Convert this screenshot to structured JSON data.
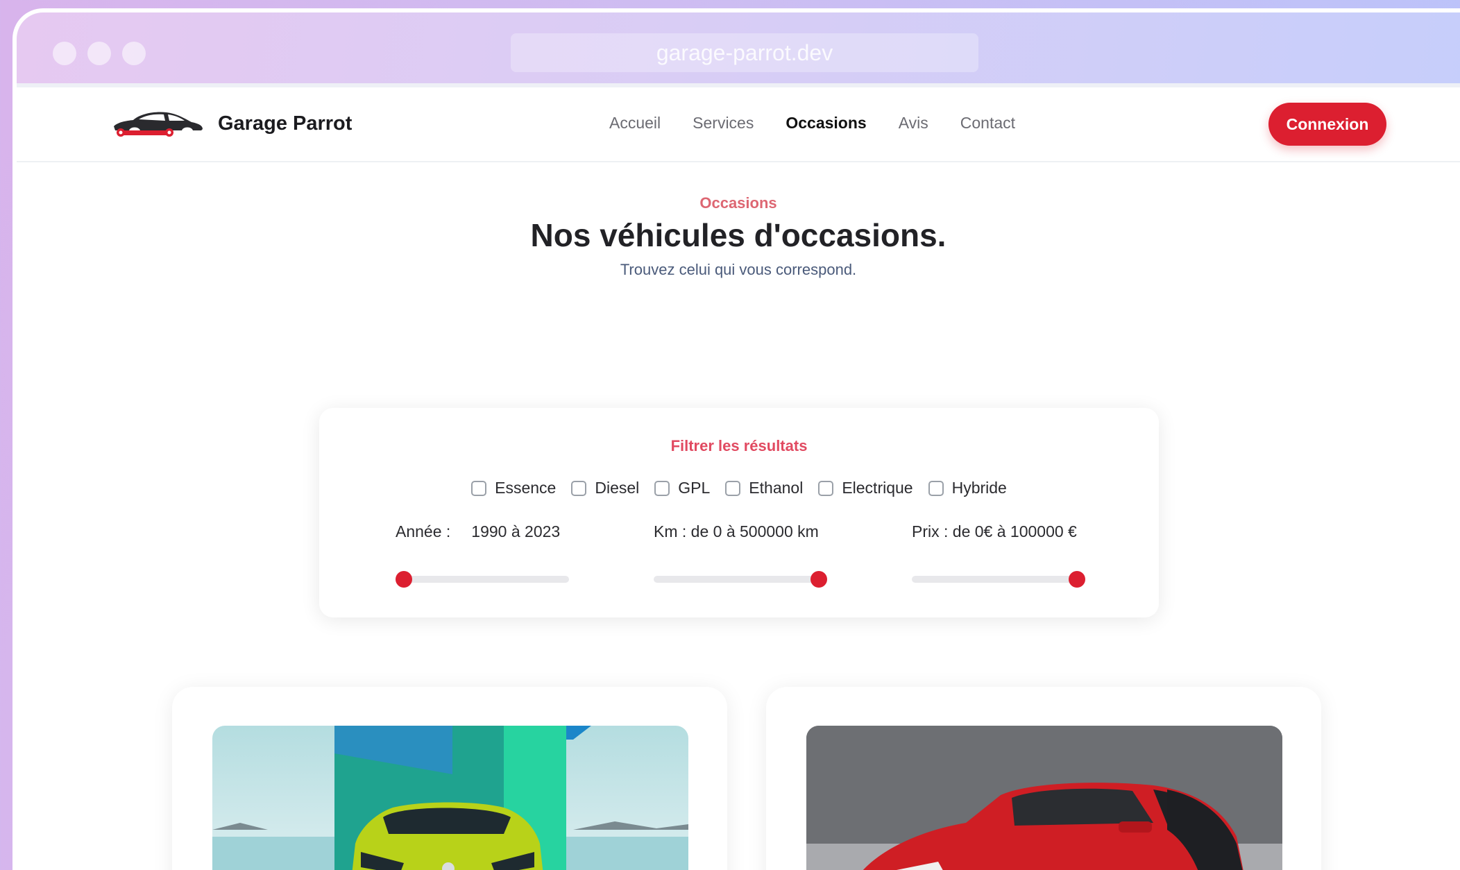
{
  "browser": {
    "url": "garage-parrot.dev"
  },
  "nav": {
    "brand": "Garage Parrot",
    "menu": [
      "Accueil",
      "Services",
      "Occasions",
      "Avis",
      "Contact"
    ],
    "active": "Occasions",
    "login_label": "Connexion"
  },
  "hero": {
    "eyebrow": "Occasions",
    "title": "Nos véhicules d'occasions.",
    "subtitle": "Trouvez celui qui vous correspond."
  },
  "filters": {
    "title": "Filtrer les résultats",
    "fuels": [
      "Essence",
      "Diesel",
      "GPL",
      "Ethanol",
      "Electrique",
      "Hybride"
    ],
    "year": {
      "label": "Année :",
      "value": "1990 à 2023",
      "position": 0
    },
    "km": {
      "label": "Km : de 0 à 500000 km",
      "position": 1
    },
    "price": {
      "label": "Prix : de 0€ à 100000 €",
      "position": 1
    }
  },
  "colors": {
    "accent": "#dc1f30",
    "eyebrow": "#dd6672"
  }
}
